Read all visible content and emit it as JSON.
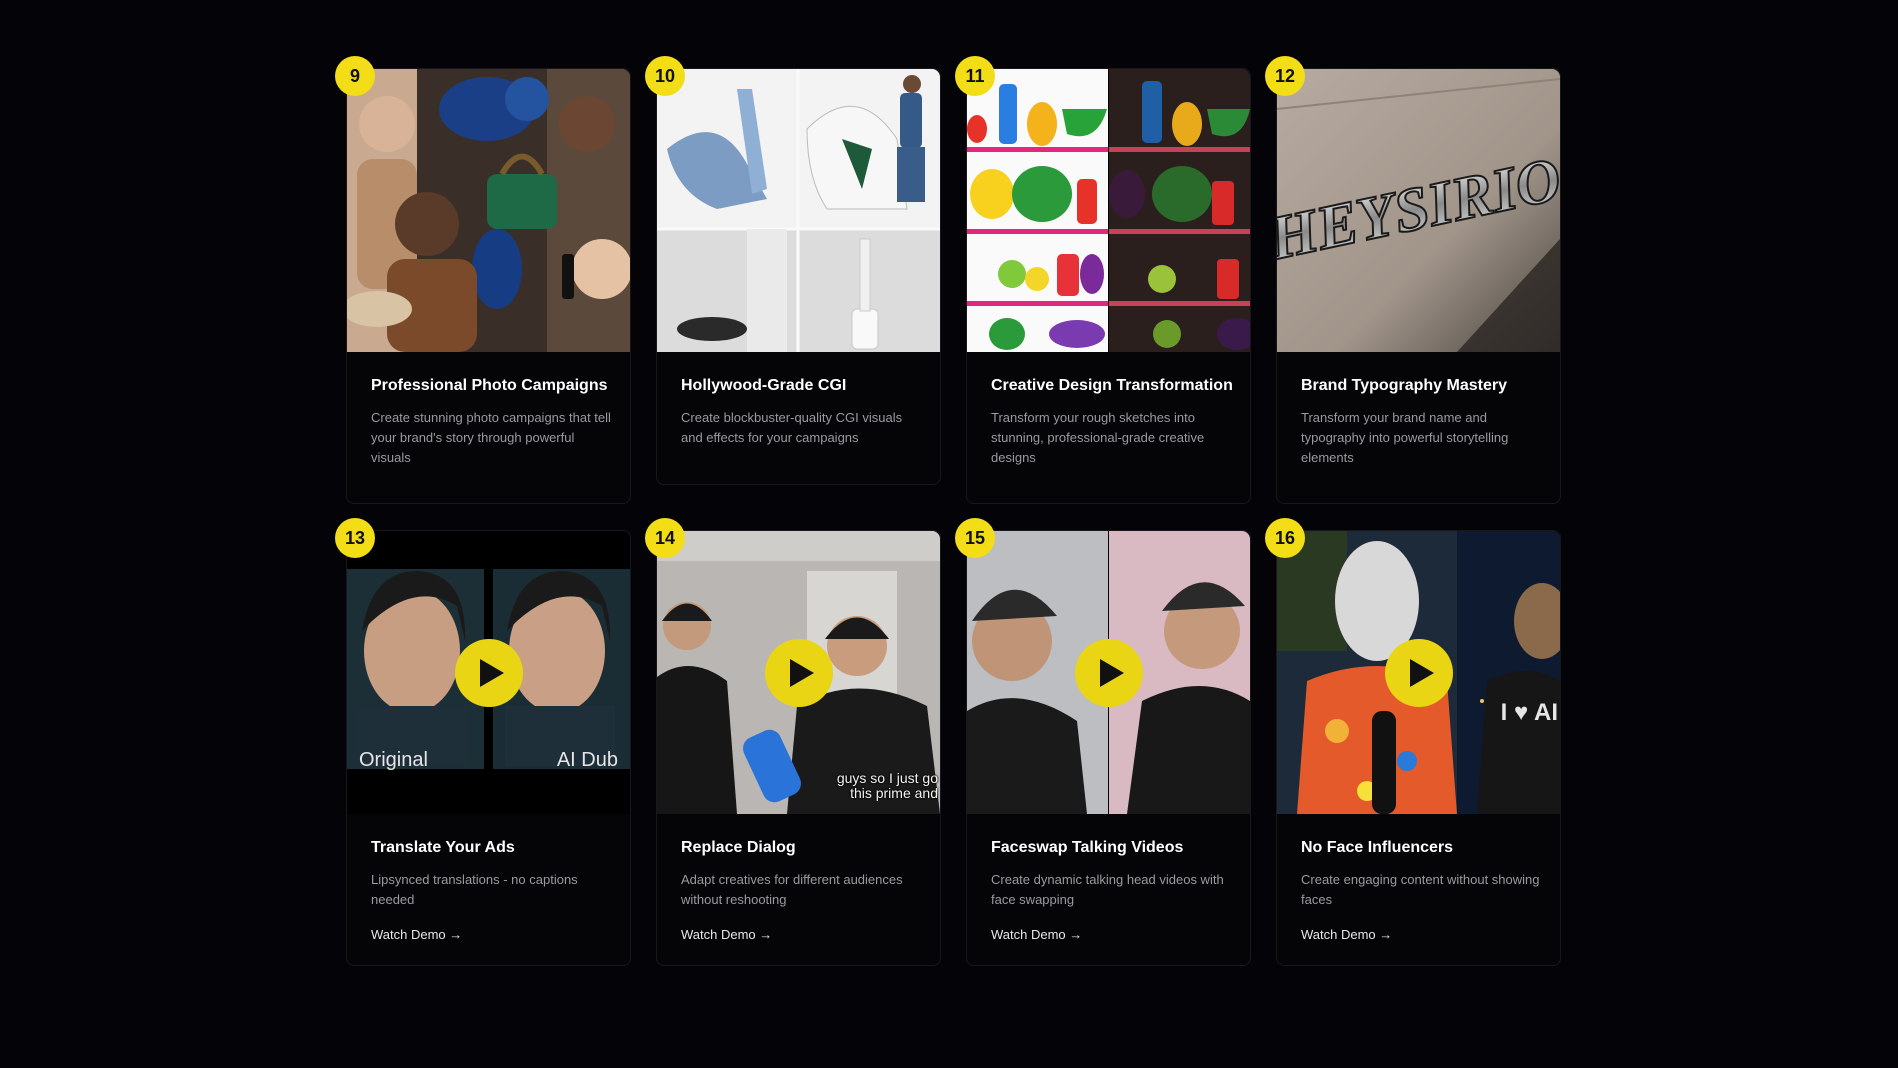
{
  "cards": [
    {
      "number": "9",
      "title": "Professional Photo Campaigns",
      "description": "Create stunning photo campaigns that tell your brand's story through powerful visuals",
      "media": "photo-collage"
    },
    {
      "number": "10",
      "title": "Hollywood-Grade CGI",
      "description": "Create blockbuster-quality CGI visuals and effects for your campaigns",
      "media": "cgi-collage"
    },
    {
      "number": "11",
      "title": "Creative Design Transformation",
      "description": "Transform your rough sketches into stunning, professional-grade creative designs",
      "media": "shelf-sketch-vs-render"
    },
    {
      "number": "12",
      "title": "Brand Typography Mastery",
      "description": "Transform your brand name and typography into powerful storytelling elements",
      "media": "chrome-lettering",
      "lettering": "HEYSIRIO"
    },
    {
      "number": "13",
      "title": "Translate Your Ads",
      "description": "Lipsynced translations - no captions needed",
      "link": "Watch Demo →",
      "media": "video",
      "captions": [
        "Original",
        "AI Dub"
      ]
    },
    {
      "number": "14",
      "title": "Replace Dialog",
      "description": "Adapt creatives for different audiences without reshooting",
      "link": "Watch Demo →",
      "media": "video",
      "subtitle": [
        "guys so I just go",
        "this prime and"
      ]
    },
    {
      "number": "15",
      "title": "Faceswap Talking Videos",
      "description": "Create dynamic talking head videos with face swapping",
      "link": "Watch Demo →",
      "media": "video"
    },
    {
      "number": "16",
      "title": "No Face Influencers",
      "description": "Create engaging content without showing faces",
      "link": "Watch Demo →",
      "media": "video",
      "shirt_text": "I ♥ AI"
    }
  ],
  "colors": {
    "background": "#040408",
    "accent": "#f2dd17",
    "card": "#050507",
    "muted_text": "#9a9aa0"
  }
}
